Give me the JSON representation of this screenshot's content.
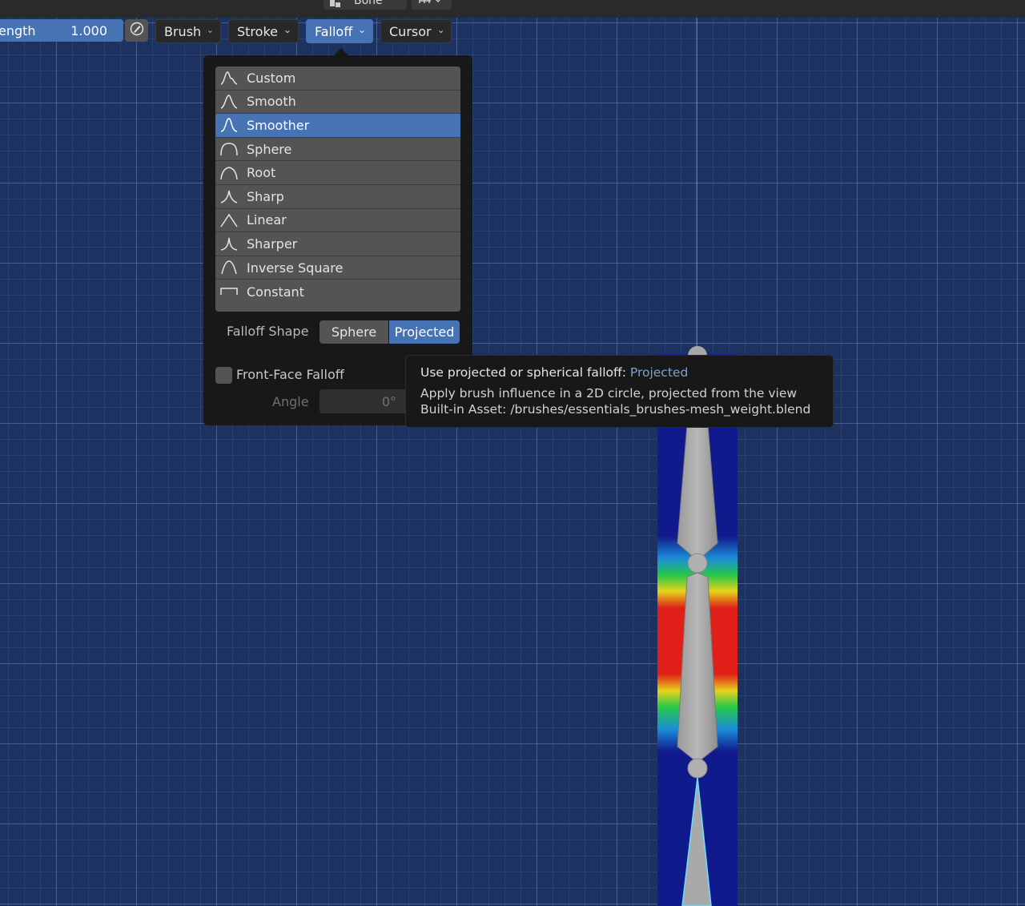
{
  "header": {
    "bone_dropdown_label": "Bone"
  },
  "toolbar": {
    "strength_label": "ength",
    "strength_value": "1.000",
    "brush_label": "Brush",
    "stroke_label": "Stroke",
    "falloff_label": "Falloff",
    "cursor_label": "Cursor"
  },
  "falloff_menu": {
    "items": [
      {
        "label": "Custom",
        "icon": "curve-custom-icon"
      },
      {
        "label": "Smooth",
        "icon": "curve-smooth-icon"
      },
      {
        "label": "Smoother",
        "icon": "curve-smoother-icon",
        "selected": true
      },
      {
        "label": "Sphere",
        "icon": "curve-sphere-icon"
      },
      {
        "label": "Root",
        "icon": "curve-root-icon"
      },
      {
        "label": "Sharp",
        "icon": "curve-sharp-icon"
      },
      {
        "label": "Linear",
        "icon": "curve-linear-icon"
      },
      {
        "label": "Sharper",
        "icon": "curve-sharper-icon"
      },
      {
        "label": "Inverse Square",
        "icon": "curve-inverse-square-icon"
      },
      {
        "label": "Constant",
        "icon": "curve-constant-icon"
      }
    ],
    "shape_label": "Falloff Shape",
    "shape_options": [
      "Sphere",
      "Projected"
    ],
    "shape_selected": "Projected",
    "front_face_label": "Front-Face Falloff",
    "angle_label": "Angle",
    "angle_value": "0°"
  },
  "tooltip": {
    "title": "Use projected or spherical falloff:",
    "title_value": "Projected",
    "line1": "Apply brush influence in a 2D circle, projected from the view",
    "line2": "Built-in Asset: /brushes/essentials_brushes-mesh_weight.blend"
  },
  "colors": {
    "accent": "#4772b3",
    "popup_bg": "#181818",
    "menu_item_bg": "#545454",
    "viewport_bg": "#1d3260"
  }
}
